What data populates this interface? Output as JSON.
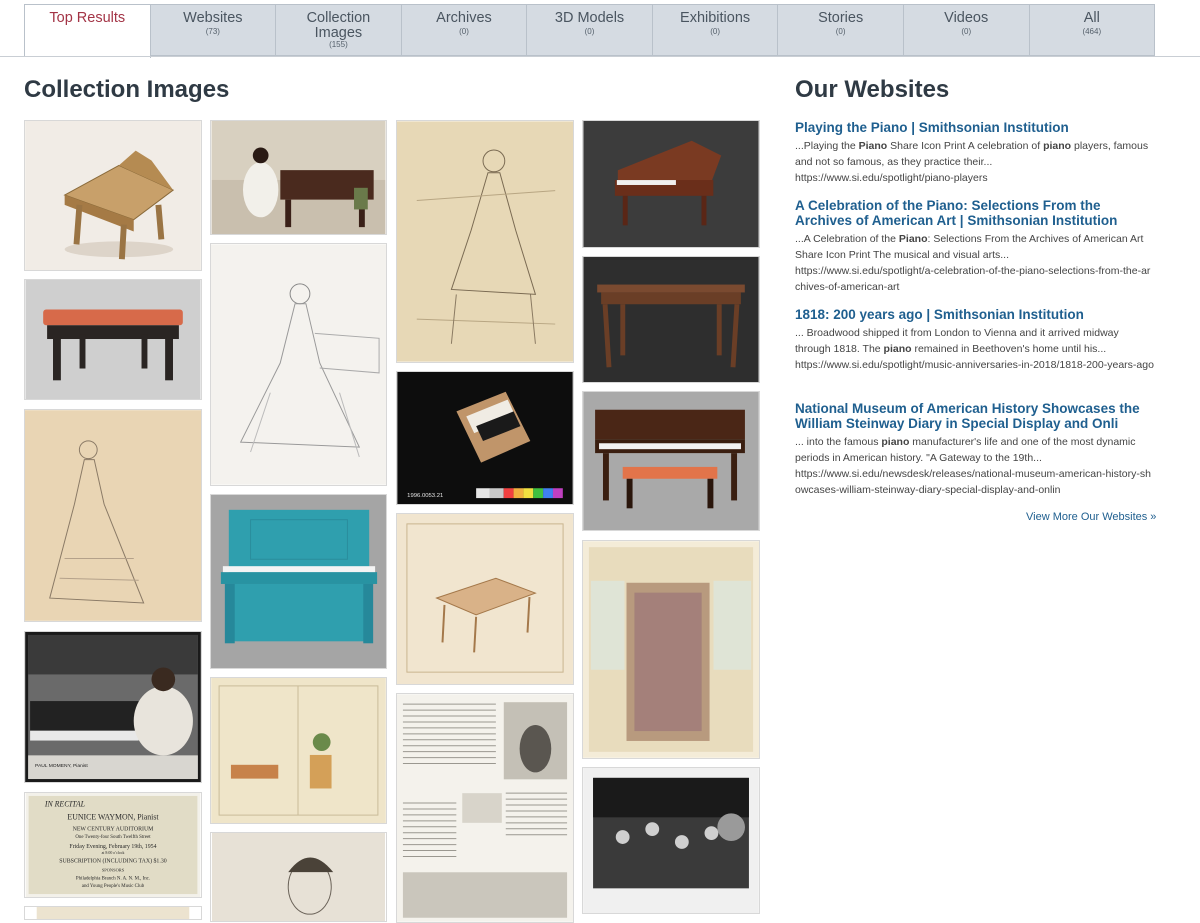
{
  "tabs": [
    {
      "label": "Top Results",
      "count": ""
    },
    {
      "label": "Websites",
      "count": "(73)"
    },
    {
      "label": "Collection Images",
      "count": "(155)"
    },
    {
      "label": "Archives",
      "count": "(0)"
    },
    {
      "label": "3D Models",
      "count": "(0)"
    },
    {
      "label": "Exhibitions",
      "count": "(0)"
    },
    {
      "label": "Stories",
      "count": "(0)"
    },
    {
      "label": "Videos",
      "count": "(0)"
    },
    {
      "label": "All",
      "count": "(464)"
    }
  ],
  "active_tab": "Top Results",
  "collection": {
    "heading": "Collection Images"
  },
  "websites": {
    "heading": "Our Websites",
    "results": [
      {
        "title": "Playing the Piano | Smithsonian Institution",
        "snippet_a": "...Playing the ",
        "snippet_b": "Piano",
        "snippet_c": " Share Icon Print A celebration of ",
        "snippet_d": "piano",
        "snippet_e": " players, famous and not so famous, as they practice their...",
        "url": "https://www.si.edu/spotlight/piano-players"
      },
      {
        "title": "A Celebration of the Piano: Selections From the Archives of American Art | Smithsonian Institution",
        "snippet_a": "...A Celebration of the ",
        "snippet_b": "Piano",
        "snippet_c": ": Selections From the Archives of American Art Share Icon Print The musical and visual arts...",
        "snippet_d": "",
        "snippet_e": "",
        "url": "https://www.si.edu/spotlight/a-celebration-of-the-piano-selections-from-the-archives-of-american-art"
      },
      {
        "title": "1818: 200 years ago | Smithsonian Institution",
        "snippet_a": "... Broadwood shipped it from London to Vienna and it arrived midway through 1818. The ",
        "snippet_b": "piano",
        "snippet_c": " remained in Beethoven's home until his...",
        "snippet_d": "",
        "snippet_e": "",
        "url": "https://www.si.edu/spotlight/music-anniversaries-in-2018/1818-200-years-ago"
      },
      {
        "title": "National Museum of American History Showcases the William Steinway Diary in Special Display and Onli",
        "snippet_a": "... into the famous ",
        "snippet_b": "piano",
        "snippet_c": " manufacturer's life and one of the most dynamic periods in American history. \"A Gateway to the 19th...",
        "snippet_d": "",
        "snippet_e": "",
        "url": "https://www.si.edu/newsdesk/releases/national-museum-american-history-showcases-william-steinway-diary-special-display-and-onlin"
      }
    ],
    "view_more": "View More Our Websites »"
  },
  "image_text": {
    "poster_caption": "PAUL MOMENY, Pianist",
    "recital_line1": "IN RECITAL",
    "recital_line2": "EUNICE WAYMON, Pianist",
    "recital_line3": "NEW CENTURY AUDITORIUM",
    "recital_line4": "One Twenty-four South Twelfth Street",
    "recital_line5": "Friday Evening, February 19th, 1954",
    "recital_line6": "at 8:00 o'clock",
    "recital_line7": "SUBSCRIPTION    (INCLUDING TAX)    $1.30",
    "recital_line8": "SPONSORS",
    "recital_line9": "Philadelphia Branch N. A. N. M., Inc.",
    "recital_line10": "and Young People's Music Club",
    "keyboard_tag": "1996.0053.21"
  }
}
